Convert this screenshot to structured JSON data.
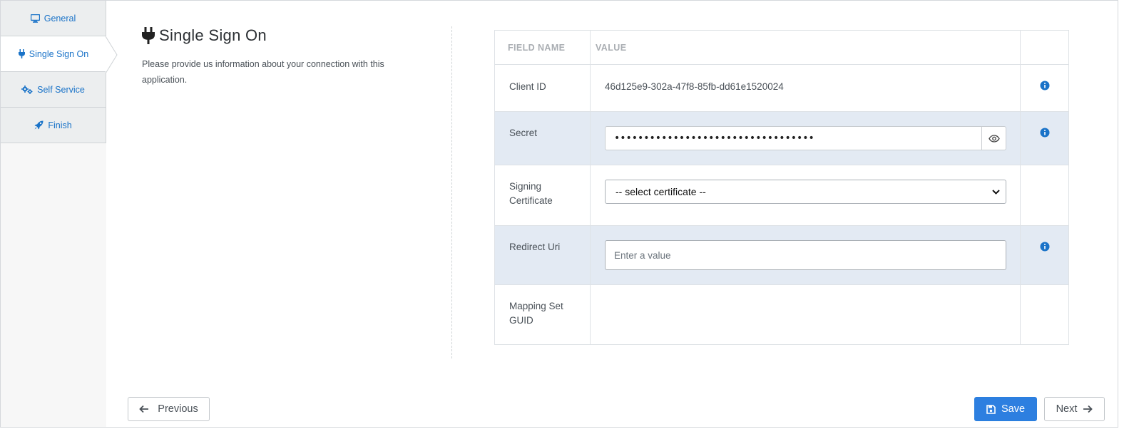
{
  "sidebar": {
    "items": [
      {
        "label": "General",
        "icon": "monitor-icon",
        "active": false
      },
      {
        "label": "Single Sign On",
        "icon": "plug-icon",
        "active": true
      },
      {
        "label": "Self Service",
        "icon": "gears-icon",
        "active": false
      },
      {
        "label": "Finish",
        "icon": "rocket-icon",
        "active": false
      }
    ]
  },
  "section": {
    "title": "Single Sign On",
    "description": "Please provide us information about your connection with this application."
  },
  "table": {
    "headers": {
      "field_name": "FIELD NAME",
      "value": "VALUE"
    },
    "rows": [
      {
        "field": "Client ID",
        "value": "46d125e9-302a-47f8-85fb-dd61e1520024"
      },
      {
        "field": "Secret",
        "value": "••••••••••••••••••••••••••••••••••"
      },
      {
        "field": "Signing Certificate",
        "value": "-- select certificate --"
      },
      {
        "field": "Redirect Uri",
        "value": "",
        "placeholder": "Enter a value"
      },
      {
        "field": "Mapping Set GUID",
        "value": ""
      }
    ]
  },
  "footer": {
    "previous_label": "Previous",
    "save_label": "Save",
    "next_label": "Next"
  },
  "colors": {
    "accent": "#2d7fe0",
    "link": "#1a73c8",
    "row_highlight": "#e3eaf3"
  }
}
